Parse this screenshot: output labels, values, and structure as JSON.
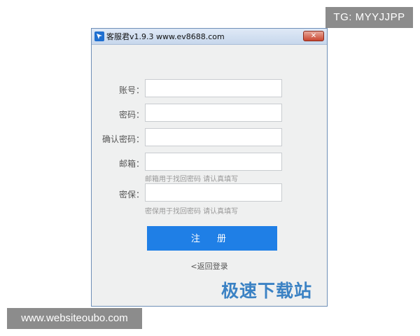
{
  "watermarks": {
    "top_right": "TG: MYYJJPP",
    "bottom_left": "www.websiteoubo.com"
  },
  "window": {
    "title": "客服君v1.9.3 www.ev8688.com",
    "close_symbol": "✕"
  },
  "form": {
    "account_label": "账号：",
    "account_value": "",
    "password_label": "密码：",
    "password_value": "",
    "confirm_label": "确认密码：",
    "confirm_value": "",
    "email_label": "邮箱：",
    "email_value": "",
    "email_hint": "邮箱用于找回密码 请认真填写",
    "security_label": "密保：",
    "security_value": "",
    "security_hint": "密保用于找回密码 请认真填写"
  },
  "actions": {
    "register_label": "注 册",
    "back_link": "<返回登录"
  },
  "brand": {
    "logo_text": "极速下载站"
  },
  "colors": {
    "register_button": "#1f7fe6",
    "brand_text": "#3b82c4",
    "window_bg": "#eff0f0"
  }
}
